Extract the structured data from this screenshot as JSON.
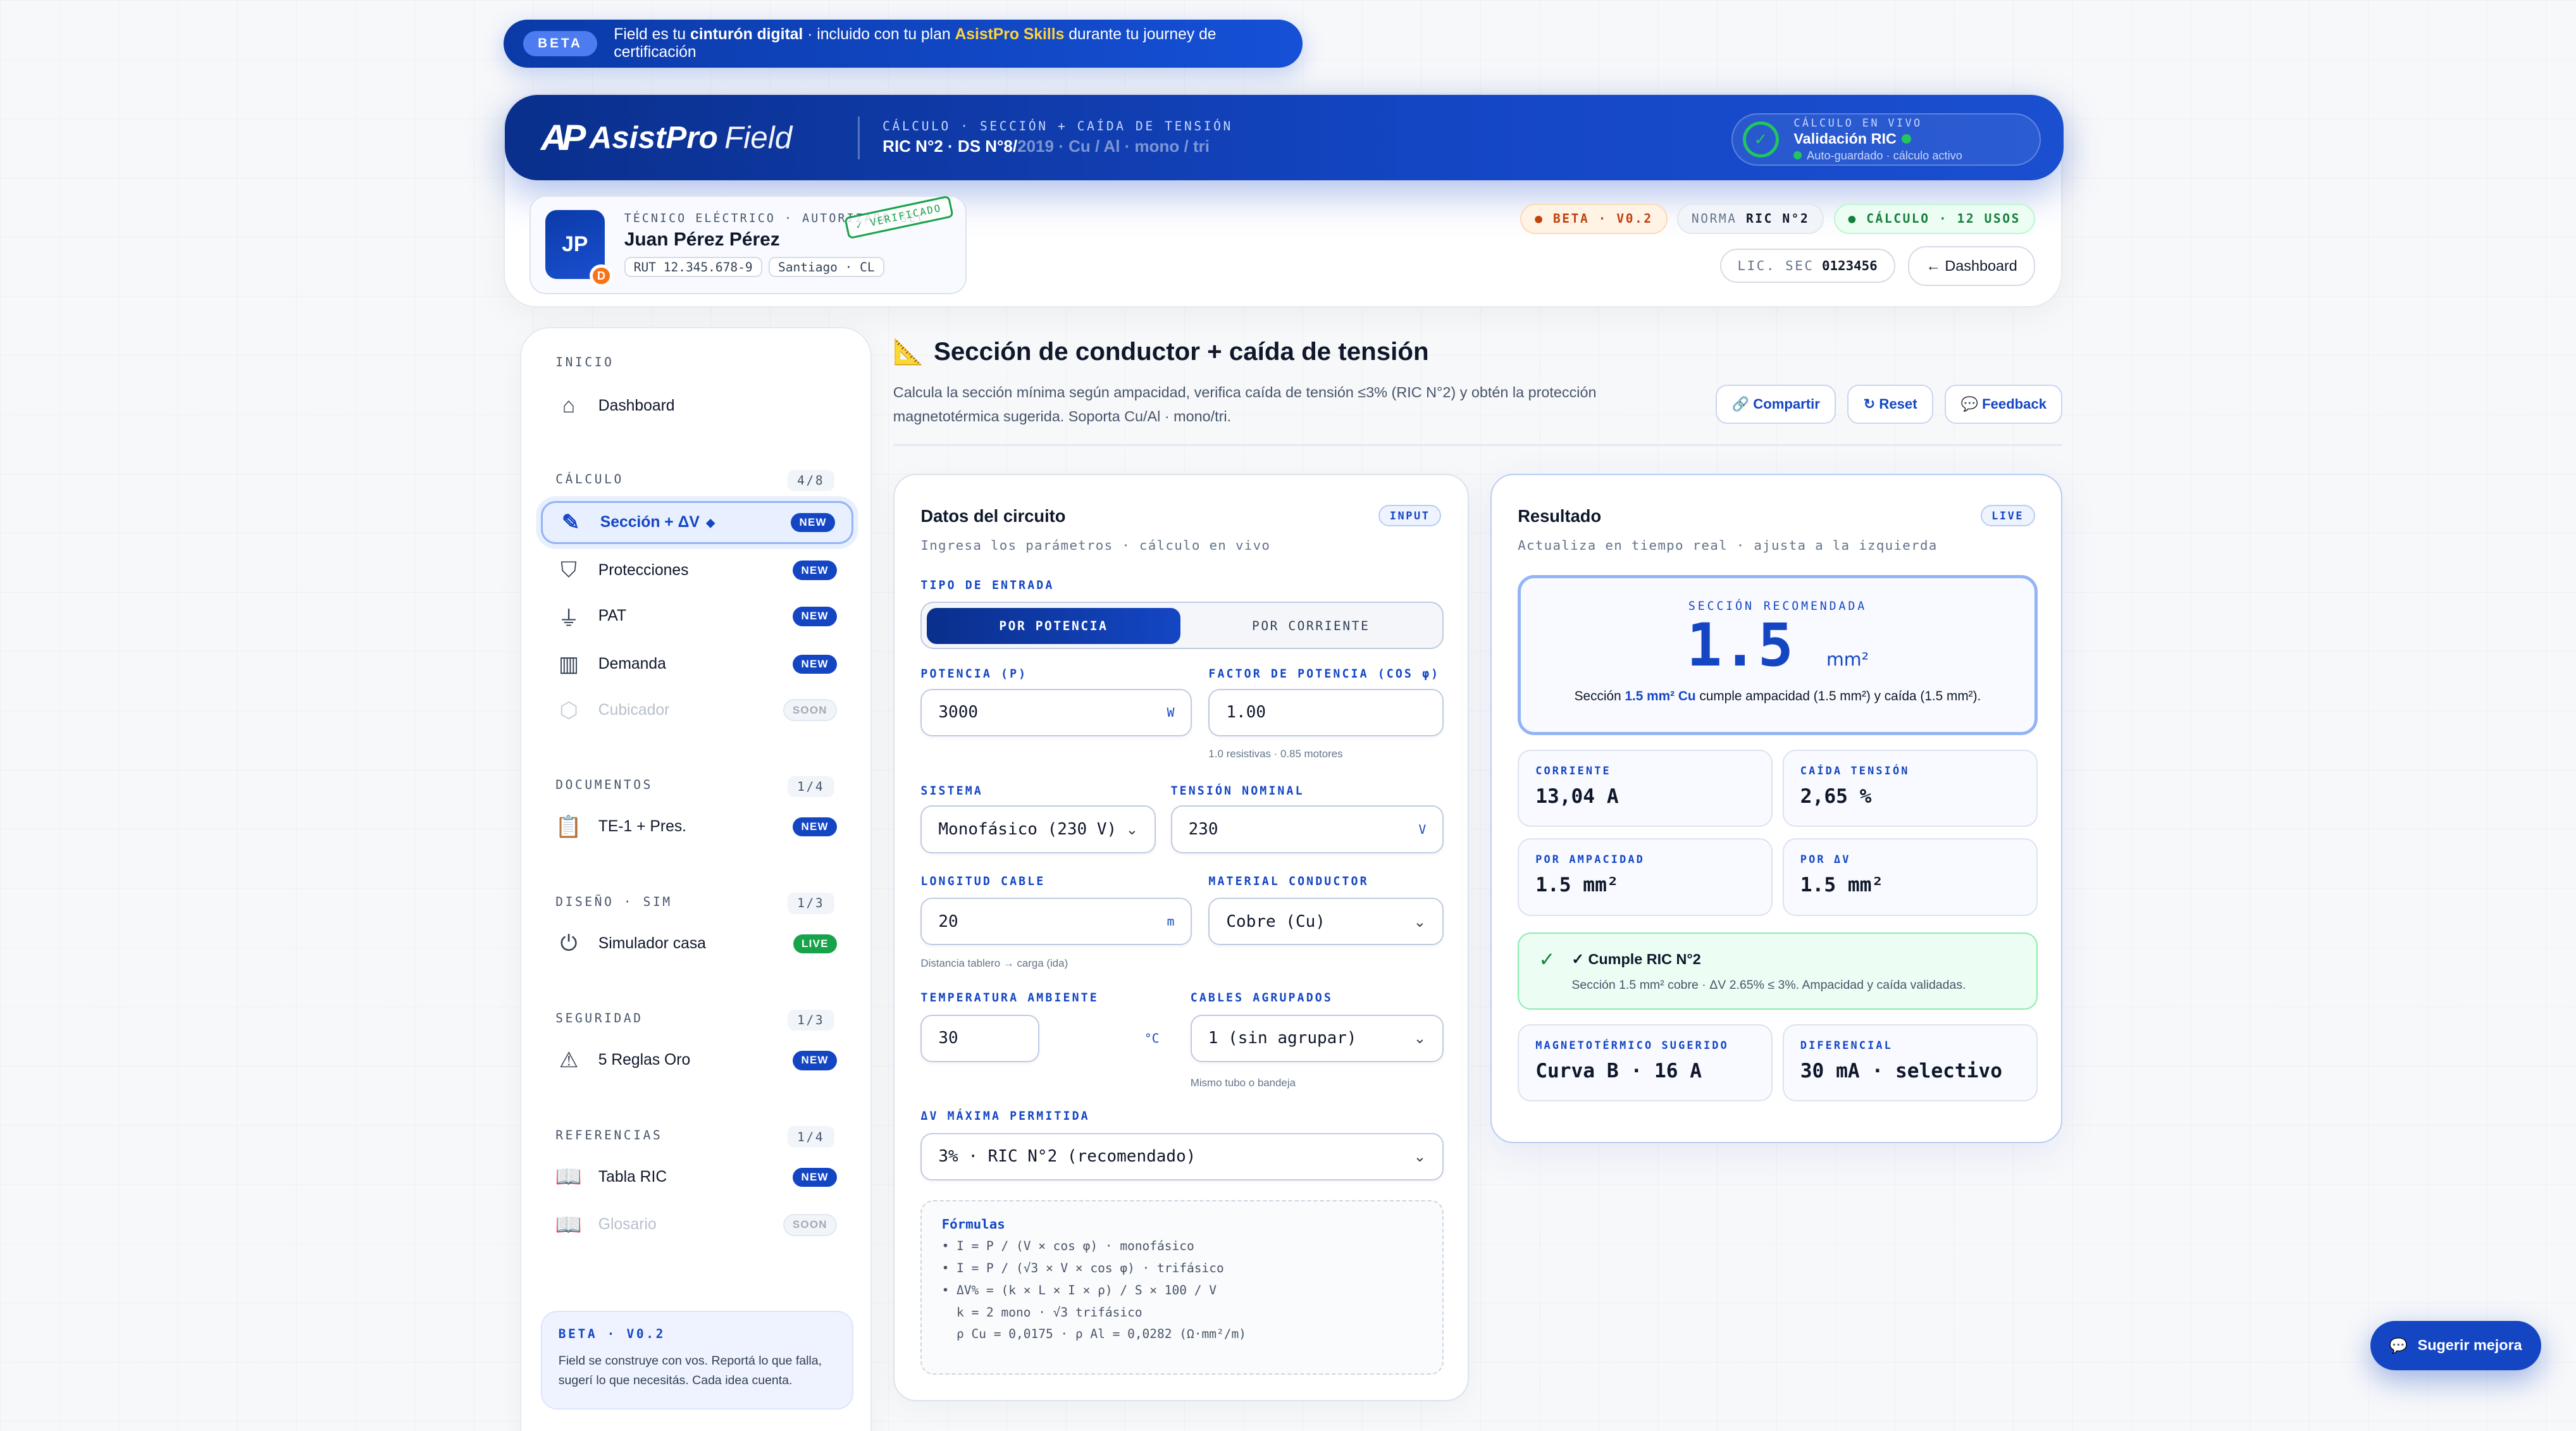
{
  "banner": {
    "pill": "BETA",
    "pre": "Field es tu",
    "strong": "cinturón digital",
    "mid": "· incluido con tu plan",
    "plan": "AsistPro Skills",
    "post": "durante tu journey de certificación"
  },
  "brand": {
    "mark": "AP",
    "name": "AsistPro",
    "sub": "Field"
  },
  "hero": {
    "crumb_top": "CÁLCULO · SECCIÓN + CAÍDA DE TENSIÓN",
    "crumb_main": "RIC N°2 · DS N°8/",
    "crumb_fade": "2019 · Cu / Al · mono / tri"
  },
  "live": {
    "label": "CÁLCULO EN VIVO",
    "title": "Validación RIC",
    "status": "Auto-guardado · cálculo activo",
    "check": "✓"
  },
  "profile": {
    "initials": "JP",
    "badge": "D",
    "role": "TÉCNICO ELÉCTRICO · AUTORIZADO SEC",
    "name": "Juan Pérez Pérez",
    "rut": "RUT 12.345.678-9",
    "city": "Santiago · CL",
    "stamp": "✓ VERIFICADO"
  },
  "chips": {
    "beta": "BETA · V0.2",
    "norma_label": "NORMA",
    "norma": "RIC N°2",
    "calc": "CÁLCULO · 12 USOS",
    "lic_label": "LIC. SEC",
    "lic": "0123456",
    "dashboard": "← Dashboard"
  },
  "sidebar": {
    "sections": [
      {
        "title": "INICIO",
        "count": ""
      },
      {
        "title": "CÁLCULO",
        "count": "4/8"
      },
      {
        "title": "DOCUMENTOS",
        "count": "1/4"
      },
      {
        "title": "DISEÑO · SIM",
        "count": "1/3"
      },
      {
        "title": "SEGURIDAD",
        "count": "1/3"
      },
      {
        "title": "REFERENCIAS",
        "count": "1/4"
      }
    ],
    "items": [
      {
        "label": "Dashboard",
        "badge": "",
        "icon": "home-icon"
      },
      {
        "label": "Sección + ΔV",
        "badge": "NEW",
        "icon": "pencil-icon"
      },
      {
        "label": "Protecciones",
        "badge": "NEW",
        "icon": "shield-icon"
      },
      {
        "label": "PAT",
        "badge": "NEW",
        "icon": "ground-icon"
      },
      {
        "label": "Demanda",
        "badge": "NEW",
        "icon": "bar-chart-icon"
      },
      {
        "label": "Cubicador",
        "badge": "SOON",
        "icon": "cube-icon"
      },
      {
        "label": "TE-1 + Pres.",
        "badge": "NEW",
        "icon": "clipboard-icon"
      },
      {
        "label": "Simulador casa",
        "badge": "LIVE",
        "icon": "plug-icon"
      },
      {
        "label": "5 Reglas Oro",
        "badge": "NEW",
        "icon": "warning-icon"
      },
      {
        "label": "Tabla RIC",
        "badge": "NEW",
        "icon": "book-icon"
      },
      {
        "label": "Glosario",
        "badge": "SOON",
        "icon": "book-icon"
      }
    ],
    "footer_title": "BETA · V0.2",
    "footer_text": "Field se construye con vos. Reportá lo que falla, sugerí lo que necesitás. Cada idea cuenta."
  },
  "page": {
    "title": "Sección de conductor + caída de tensión",
    "desc": "Calcula la sección mínima según ampacidad, verifica caída de tensión ≤3% (RIC N°2) y obtén la protección magnetotérmica sugerida. Soporta Cu/Al · mono/tri.",
    "share": "🔗 Compartir",
    "reset": "↻ Reset",
    "feedback": "💬 Feedback"
  },
  "input_panel": {
    "title": "Datos del circuito",
    "subtitle": "Ingresa los parámetros · cálculo en vivo",
    "pill": "INPUT",
    "tipo_label": "TIPO DE ENTRADA",
    "tipo_on": "POR POTENCIA",
    "tipo_off": "POR CORRIENTE",
    "potencia_label": "POTENCIA (P)",
    "potencia_value": "3000",
    "potencia_unit": "W",
    "fp_label": "FACTOR DE POTENCIA (COS φ)",
    "fp_value": "1.00",
    "fp_help": "1.0 resistivas · 0.85 motores",
    "sistema_label": "SISTEMA",
    "sistema_value": "Monofásico (230 V)",
    "tension_label": "TENSIÓN NOMINAL",
    "tension_value": "230",
    "tension_unit": "V",
    "longitud_label": "LONGITUD CABLE",
    "longitud_value": "20",
    "longitud_unit": "m",
    "longitud_help": "Distancia tablero → carga (ida)",
    "material_label": "MATERIAL CONDUCTOR",
    "material_value": "Cobre (Cu)",
    "temp_label": "TEMPERATURA AMBIENTE",
    "temp_value": "30",
    "temp_unit": "°C",
    "cables_label": "CABLES AGRUPADOS",
    "cables_value": "1 (sin agrupar)",
    "cables_help": "Mismo tubo o bandeja",
    "dv_label": "ΔV MÁXIMA PERMITIDA",
    "dv_value": "3% · RIC N°2 (recomendado)",
    "formulas_title": "Fórmulas",
    "formulas": [
      "• I = P / (V × cos φ) · monofásico",
      "• I = P / (√3 × V × cos φ) · trifásico",
      "• ΔV% = (k × L × I × ρ) / S × 100 / V",
      "  k = 2 mono · √3 trifásico",
      "  ρ Cu = 0,0175 · ρ Al = 0,0282 (Ω·mm²/m)"
    ]
  },
  "result_panel": {
    "title": "Resultado",
    "subtitle": "Actualiza en tiempo real · ajusta a la izquierda",
    "pill": "LIVE",
    "seccion_label": "SECCIÓN RECOMENDADA",
    "seccion_value": "1.5",
    "seccion_unit": "mm²",
    "note_pre": "Sección",
    "note_bold": "1.5 mm² Cu",
    "note_post": "cumple ampacidad (1.5 mm²) y caída (1.5 mm²).",
    "corriente_label": "CORRIENTE",
    "corriente_value": "13,04 A",
    "caida_label": "CAÍDA TENSIÓN",
    "caida_value": "2,65 %",
    "ampacidad_label": "POR AMPACIDAD",
    "ampacidad_value": "1.5 mm²",
    "pordv_label": "POR ΔV",
    "pordv_value": "1.5 mm²",
    "ok_title": "✓ Cumple RIC N°2",
    "ok_desc": "Sección 1.5 mm² cobre · ΔV 2.65% ≤ 3%. Ampacidad y caída validadas.",
    "magneto_label": "MAGNETOTÉRMICO SUGERIDO",
    "magneto_value": "Curva B · 16 A",
    "diferencial_label": "DIFERENCIAL",
    "diferencial_value": "30 mA · selectivo"
  },
  "fab": {
    "label": "Sugerir mejora",
    "icon": "💬"
  }
}
